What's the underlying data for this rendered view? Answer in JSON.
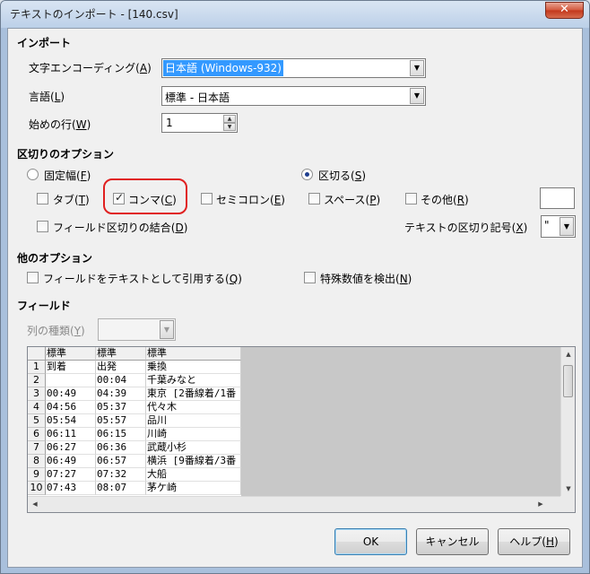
{
  "window": {
    "title": "テキストのインポート - [140.csv]",
    "close": "✕"
  },
  "import": {
    "heading": "インポート",
    "charset_label": "文字エンコーディング(",
    "charset_key": "A",
    "charset_value": "日本語 (Windows-932)",
    "language_label": "言語(",
    "language_key": "L",
    "language_value": "標準 - 日本語",
    "from_row_label": "始めの行(",
    "from_row_key": "W",
    "from_row_value": "1"
  },
  "separator": {
    "heading": "区切りのオプション",
    "fixed_label": "固定幅(",
    "fixed_key": "F",
    "separated_label": "区切る(",
    "separated_key": "S",
    "tab_label": "タブ(",
    "tab_key": "T",
    "comma_label": "コンマ(",
    "comma_key": "C",
    "semicolon_label": "セミコロン(",
    "semicolon_key": "E",
    "space_label": "スペース(",
    "space_key": "P",
    "other_label": "その他(",
    "other_key": "R",
    "merge_label": "フィールド区切りの結合(",
    "merge_key": "D",
    "text_delim_label": "テキストの区切り記号(",
    "text_delim_key": "X",
    "text_delim_value": "\""
  },
  "other_options": {
    "heading": "他のオプション",
    "quoted_label": "フィールドをテキストとして引用する(",
    "quoted_key": "Q",
    "special_label": "特殊数値を検出(",
    "special_key": "N"
  },
  "fields": {
    "heading": "フィールド",
    "col_type_label": "列の種類(",
    "col_type_key": "Y"
  },
  "preview": {
    "headers": [
      "標準",
      "標準",
      "標準"
    ],
    "rows": [
      [
        "1",
        "到着",
        "出発",
        "乗換"
      ],
      [
        "2",
        "",
        "00:04",
        "千葉みなと"
      ],
      [
        "3",
        "00:49",
        "04:39",
        "東京 [2番線着/1番"
      ],
      [
        "4",
        "04:56",
        "05:37",
        "代々木"
      ],
      [
        "5",
        "05:54",
        "05:57",
        "品川"
      ],
      [
        "6",
        "06:11",
        "06:15",
        "川崎"
      ],
      [
        "7",
        "06:27",
        "06:36",
        "武蔵小杉"
      ],
      [
        "8",
        "06:49",
        "06:57",
        "横浜 [9番線着/3番"
      ],
      [
        "9",
        "07:27",
        "07:32",
        "大船"
      ],
      [
        "10",
        "07:43",
        "08:07",
        "茅ケ崎"
      ]
    ]
  },
  "buttons": {
    "ok": "OK",
    "cancel": "キャンセル",
    "help_label": "ヘルプ(",
    "help_key": "H"
  }
}
